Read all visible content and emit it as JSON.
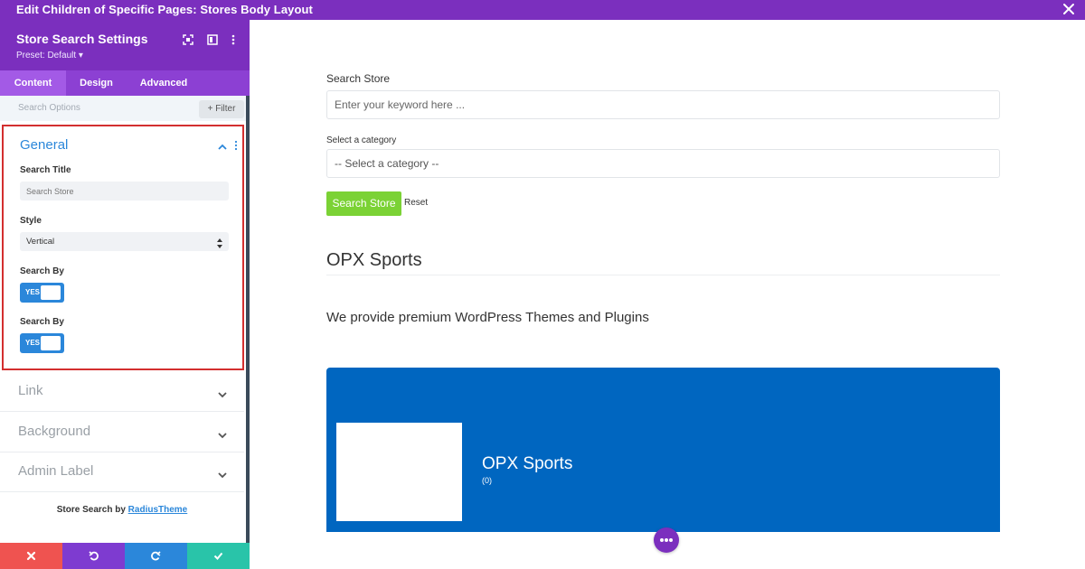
{
  "window": {
    "title": "Edit Children of Specific Pages: Stores Body Layout",
    "close_icon": "close-icon"
  },
  "panel": {
    "title": "Store Search Settings",
    "preset": "Preset: Default ▾",
    "header_icons": [
      "fullscreen-icon",
      "sidebar-icon",
      "kebab-icon"
    ],
    "tabs": [
      {
        "label": "Content",
        "active": true
      },
      {
        "label": "Design",
        "active": false
      },
      {
        "label": "Advanced",
        "active": false
      }
    ],
    "search_placeholder": "Search Options",
    "filter_label": "+ Filter",
    "general": {
      "title": "General",
      "search_title_label": "Search Title",
      "search_title_value": "Search Store",
      "style_label": "Style",
      "style_value": "Vertical",
      "search_by_label_1": "Search By",
      "toggle_1": "YES",
      "search_by_label_2": "Search By",
      "toggle_2": "YES"
    },
    "sections": [
      {
        "label": "Link"
      },
      {
        "label": "Background"
      },
      {
        "label": "Admin Label"
      }
    ],
    "credit_prefix": "Store Search by ",
    "credit_link": "RadiusTheme"
  },
  "preview": {
    "search_label": "Search Store",
    "search_placeholder": "Enter your keyword here ...",
    "category_label": "Select a category",
    "category_value": "-- Select a category --",
    "search_button": "Search Store",
    "reset_label": "Reset",
    "store_name": "OPX Sports",
    "store_description": "We provide premium WordPress Themes and Plugins",
    "card_store_name": "OPX Sports",
    "card_store_count": "(0)"
  },
  "colors": {
    "header_purple": "#7b2fbe",
    "accent_blue": "#2b87da",
    "highlight_red": "#d32f2f",
    "action_red": "#ef5350",
    "action_purple": "#7e3bd0",
    "action_blue": "#2b87da",
    "action_green": "#29c4a9",
    "button_green": "#7bd235",
    "card_blue": "#0066c0"
  }
}
